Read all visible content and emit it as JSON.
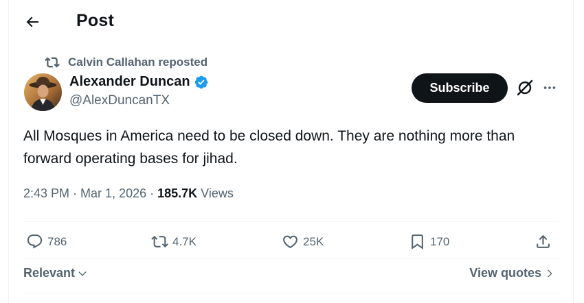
{
  "header": {
    "title": "Post",
    "back_icon": "arrow-left-icon"
  },
  "repost": {
    "icon": "repost-icon",
    "text": "Calvin Callahan reposted"
  },
  "author": {
    "display_name": "Alexander Duncan",
    "handle": "@AlexDuncanTX",
    "verified_color": "#1d9bf0"
  },
  "buttons": {
    "subscribe_label": "Subscribe",
    "grok_icon": "grok-icon",
    "more_icon": "more-icon"
  },
  "post": {
    "text": "All Mosques in America need to be closed down. They are nothing more than forward operating bases for jihad.",
    "time": "2:43 PM",
    "separator": "·",
    "date": "Mar 1, 2026",
    "views_count": "185.7K",
    "views_label": "Views"
  },
  "actions": {
    "replies": "786",
    "reposts": "4.7K",
    "likes": "25K",
    "bookmarks": "170"
  },
  "footer": {
    "sort_label": "Relevant",
    "view_quotes_label": "View quotes"
  },
  "colors": {
    "text": "#0f1419",
    "muted": "#536471",
    "accent": "#1d9bf0",
    "divider": "#eff3f4"
  }
}
